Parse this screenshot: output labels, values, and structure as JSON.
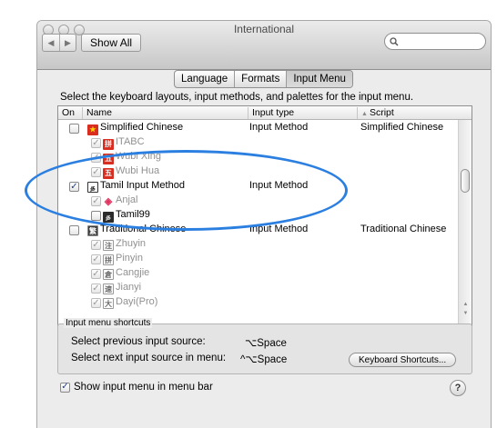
{
  "window": {
    "title": "International",
    "show_all_label": "Show All",
    "search_placeholder": ""
  },
  "tabs": [
    {
      "label": "Language",
      "active": false
    },
    {
      "label": "Formats",
      "active": false
    },
    {
      "label": "Input Menu",
      "active": true
    }
  ],
  "instructions": "Select the keyboard layouts, input methods, and palettes for the input menu.",
  "table": {
    "headers": {
      "on": "On",
      "name": "Name",
      "input_type": "Input type",
      "script": "Script"
    },
    "rows": [
      {
        "name": "Simplified Chinese",
        "input_type": "Input Method",
        "script": "Simplified Chinese",
        "checked": false,
        "level": 0,
        "icon": "china-flag-icon"
      },
      {
        "name": "ITABC",
        "input_type": "",
        "script": "",
        "checked": true,
        "level": 1,
        "icon": "itabc-icon"
      },
      {
        "name": "Wubi Xing",
        "input_type": "",
        "script": "",
        "checked": true,
        "level": 1,
        "icon": "wubi-xing-icon"
      },
      {
        "name": "Wubi Hua",
        "input_type": "",
        "script": "",
        "checked": true,
        "level": 1,
        "icon": "wubi-hua-icon"
      },
      {
        "name": "Tamil Input Method",
        "input_type": "Input Method",
        "script": "",
        "checked": true,
        "level": 0,
        "icon": "tamil-icon"
      },
      {
        "name": "Anjal",
        "input_type": "",
        "script": "",
        "checked": true,
        "level": 1,
        "icon": "anjal-icon"
      },
      {
        "name": "Tamil99",
        "input_type": "",
        "script": "",
        "checked": false,
        "level": 1,
        "icon": "tamil99-icon"
      },
      {
        "name": "Traditional Chinese",
        "input_type": "Input Method",
        "script": "Traditional Chinese",
        "checked": false,
        "level": 0,
        "icon": "taiwan-flag-icon"
      },
      {
        "name": "Zhuyin",
        "input_type": "",
        "script": "",
        "checked": true,
        "level": 1,
        "icon": "zhuyin-icon"
      },
      {
        "name": "Pinyin",
        "input_type": "",
        "script": "",
        "checked": true,
        "level": 1,
        "icon": "pinyin-icon"
      },
      {
        "name": "Cangjie",
        "input_type": "",
        "script": "",
        "checked": true,
        "level": 1,
        "icon": "cangjie-icon"
      },
      {
        "name": "Jianyi",
        "input_type": "",
        "script": "",
        "checked": true,
        "level": 1,
        "icon": "jianyi-icon"
      },
      {
        "name": "Dayi(Pro)",
        "input_type": "",
        "script": "",
        "checked": true,
        "level": 1,
        "icon": "dayi-icon"
      }
    ]
  },
  "shortcuts": {
    "group_label": "Input menu shortcuts",
    "previous_label": "Select previous input source:",
    "previous_key": "⌥Space",
    "next_label": "Select next input source in menu:",
    "next_key": "^⌥Space",
    "keyboard_shortcuts_button": "Keyboard Shortcuts..."
  },
  "show_menu": {
    "label": "Show input menu in menu bar",
    "checked": true
  },
  "help_label": "?",
  "colors": {
    "annotation": "#2b7fe0",
    "accent": "#1d3f8f"
  }
}
